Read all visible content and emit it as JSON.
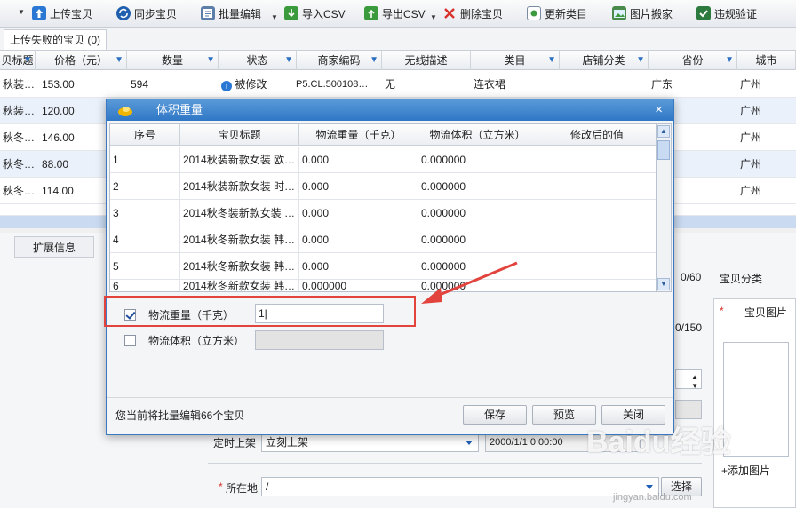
{
  "toolbar": {
    "upload": "上传宝贝",
    "sync": "同步宝贝",
    "batch_edit": "批量编辑",
    "import_csv": "导入CSV",
    "export_csv": "导出CSV",
    "delete": "删除宝贝",
    "update_category": "更新类目",
    "move_images": "图片搬家",
    "violation_check": "违规验证"
  },
  "tabs": {
    "upload_failed": "上传失败的宝贝 (0)"
  },
  "grid": {
    "headers": [
      "贝标题",
      "价格（元）",
      "数量",
      "状态",
      "商家编码",
      "无线描述",
      "类目",
      "店铺分类",
      "省份",
      "城市"
    ],
    "rows": [
      {
        "title": "秋装…",
        "price": "153.00",
        "qty": "594",
        "status": "被修改",
        "code": "P5.CL.500108…",
        "wireless": "无",
        "category": "连衣裙",
        "shop_cat": "",
        "province": "广东",
        "city": "广州"
      },
      {
        "title": "秋装…",
        "price": "120.00",
        "qty": "",
        "status": "",
        "code": "",
        "wireless": "",
        "category": "",
        "shop_cat": "",
        "province": "",
        "city": "广州"
      },
      {
        "title": "秋冬…",
        "price": "146.00",
        "qty": "",
        "status": "",
        "code": "",
        "wireless": "",
        "category": "",
        "shop_cat": "",
        "province": "",
        "city": "广州"
      },
      {
        "title": "秋冬…",
        "price": "88.00",
        "qty": "",
        "status": "",
        "code": "",
        "wireless": "",
        "category": "",
        "shop_cat": "",
        "province": "",
        "city": "广州"
      },
      {
        "title": "秋冬…",
        "price": "114.00",
        "qty": "",
        "status": "",
        "code": "",
        "wireless": "",
        "category": "",
        "shop_cat": "",
        "province": "",
        "city": "广州"
      }
    ]
  },
  "lower": {
    "tab_ext": "扩展信息",
    "count_a": "0/60",
    "count_b": "0/150",
    "baobei_category": "宝贝分类",
    "baobei_images_star": "*",
    "baobei_images": "宝贝图片",
    "add_image": "添加图片",
    "schedule_label": "定时上架",
    "schedule_value": "立刻上架",
    "schedule_datetime": "2000/1/1 0:00:00",
    "location_star": "*",
    "location_label": "所在地",
    "location_value": "/",
    "select_button": "选择"
  },
  "dialog": {
    "title": "体积重量",
    "close": "×",
    "headers": [
      "序号",
      "宝贝标题",
      "物流重量（千克）",
      "物流体积（立方米）",
      "修改后的值"
    ],
    "rows": [
      {
        "no": "1",
        "title": "2014秋装新款女装 欧…",
        "weight": "0.000",
        "volume": "0.000000",
        "new": ""
      },
      {
        "no": "2",
        "title": "2014秋装新款女装 时…",
        "weight": "0.000",
        "volume": "0.000000",
        "new": ""
      },
      {
        "no": "3",
        "title": "2014秋冬装新款女装 …",
        "weight": "0.000",
        "volume": "0.000000",
        "new": ""
      },
      {
        "no": "4",
        "title": "2014秋冬新款女装 韩…",
        "weight": "0.000",
        "volume": "0.000000",
        "new": ""
      },
      {
        "no": "5",
        "title": "2014秋冬新款女装 韩…",
        "weight": "0.000",
        "volume": "0.000000",
        "new": ""
      },
      {
        "no": "6",
        "title": "2014秋冬新款女装 韩…",
        "weight": "0.000000",
        "volume": "0.000000",
        "new": ""
      }
    ],
    "weight_label": "物流重量（千克）",
    "weight_value": "1|",
    "volume_label": "物流体积（立方米）",
    "footer": "您当前将批量编辑66个宝贝",
    "save": "保存",
    "preview": "预览",
    "close_button": "关闭"
  },
  "watermark": {
    "main": "Baidu经验",
    "sub": "jingyan.baidu.com"
  },
  "colors": {
    "accent": "#2f77c6",
    "highlight": "#e2433d",
    "row_alt": "#eaf1fb"
  }
}
